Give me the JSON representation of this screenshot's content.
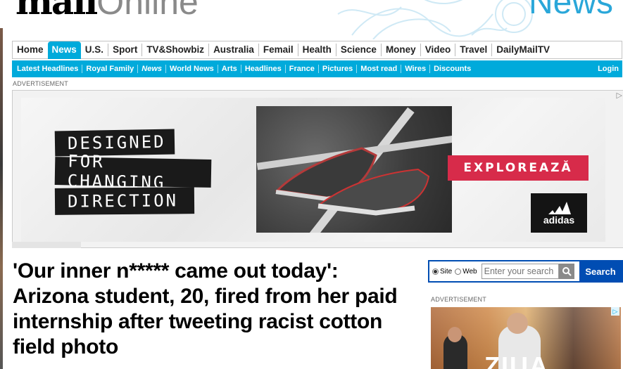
{
  "masthead": {
    "logo_mail": "mail",
    "logo_online": "Online",
    "section": "News",
    "accent_color": "#00aadb"
  },
  "nav_primary": {
    "items": [
      "Home",
      "News",
      "U.S.",
      "Sport",
      "TV&Showbiz",
      "Australia",
      "Femail",
      "Health",
      "Science",
      "Money",
      "Video",
      "Travel",
      "DailyMailTV"
    ],
    "active": "News"
  },
  "nav_secondary": {
    "items": [
      "Latest Headlines",
      "Royal Family",
      "News",
      "World News",
      "Arts",
      "Headlines",
      "France",
      "Pictures",
      "Most read",
      "Wires",
      "Discounts"
    ],
    "login": "Login"
  },
  "ad_top": {
    "label": "ADVERTISEMENT",
    "line1": "DESIGNED",
    "line2": "FOR CHANGING",
    "line3": "DIRECTION",
    "cta": "EXPLOREAZĂ",
    "brand": "adidas",
    "adchoice_icon": "adchoices-icon"
  },
  "article": {
    "headline": "'Our inner n***** came out today': Arizona student, 20, fired from her paid internship after tweeting racist cotton field photo"
  },
  "search": {
    "option_site": "Site",
    "option_web": "Web",
    "selected": "Site",
    "placeholder": "Enter your search",
    "button": "Search"
  },
  "ad_side": {
    "label": "ADVERTISEMENT",
    "text": "ZIUA"
  }
}
